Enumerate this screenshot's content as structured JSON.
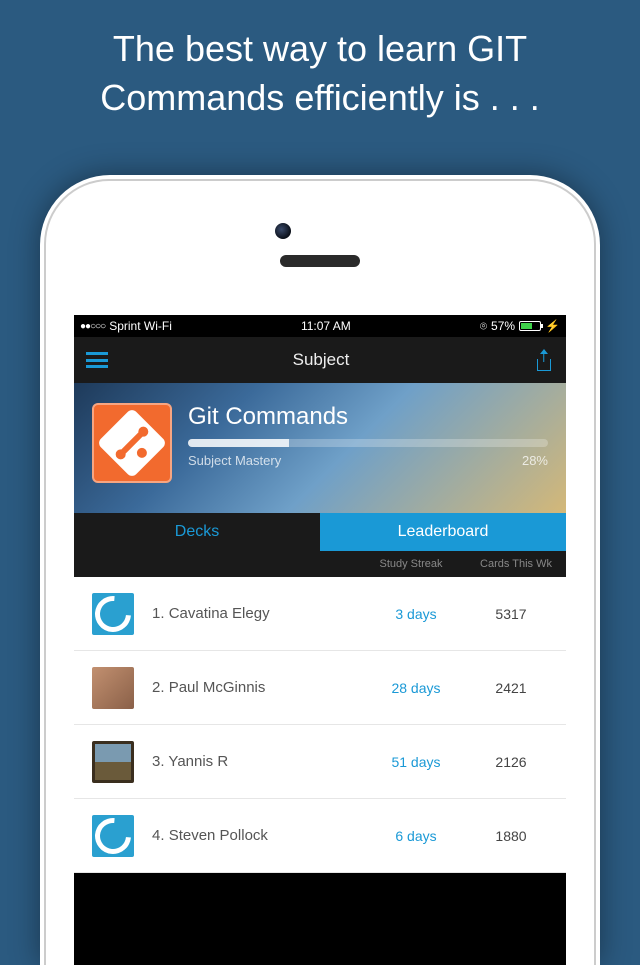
{
  "promo": "The best way to learn GIT Commands efficiently is . . .",
  "statusbar": {
    "carrier": "Sprint Wi-Fi",
    "time": "11:07 AM",
    "battery_pct": "57%"
  },
  "navbar": {
    "title": "Subject"
  },
  "header": {
    "title": "Git Commands",
    "mastery_label": "Subject Mastery",
    "mastery_pct": "28%"
  },
  "tabs": {
    "decks": "Decks",
    "leaderboard": "Leaderboard"
  },
  "columns": {
    "streak": "Study Streak",
    "cards": "Cards This Wk"
  },
  "rows": [
    {
      "rank": "1.",
      "name": "Cavatina Elegy",
      "streak": "3 days",
      "cards": "5317",
      "avatar": "ring"
    },
    {
      "rank": "2.",
      "name": "Paul McGinnis",
      "streak": "28 days",
      "cards": "2421",
      "avatar": "photo"
    },
    {
      "rank": "3.",
      "name": "Yannis R",
      "streak": "51 days",
      "cards": "2126",
      "avatar": "painting"
    },
    {
      "rank": "4.",
      "name": "Steven Pollock",
      "streak": "6 days",
      "cards": "1880",
      "avatar": "ring"
    }
  ]
}
